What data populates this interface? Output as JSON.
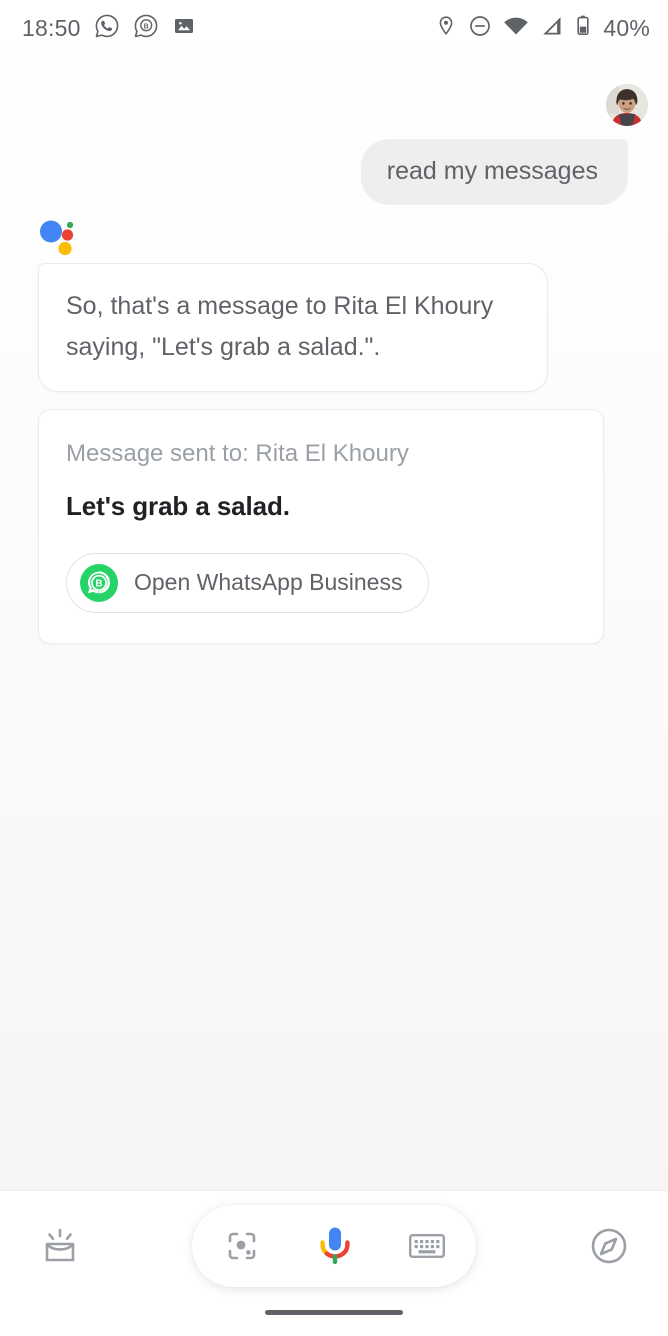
{
  "status_bar": {
    "time": "18:50",
    "battery_percent": "40%",
    "left_icons": [
      "whatsapp-icon",
      "whatsapp-business-icon",
      "photo-icon"
    ],
    "right_icons": [
      "location-icon",
      "do-not-disturb-icon",
      "wifi-icon",
      "cellular-signal-icon",
      "battery-icon"
    ],
    "text_color": "#5f6368"
  },
  "conversation": {
    "user_turn": {
      "avatar_name": "user-avatar",
      "message": "read my messages",
      "bubble_color": "#eeeeee",
      "text_color": "#5f6368"
    },
    "assistant_turn": {
      "logo_name": "google-assistant-logo",
      "logo_colors": {
        "blue": "#4285f4",
        "red": "#ea4335",
        "yellow": "#fbbc05",
        "green": "#34a853"
      },
      "message": "So, that's a message to Rita El Khoury saying, \"Let's grab a salad.\"."
    },
    "message_card": {
      "sent_to_label": "Message sent to: Rita El Khoury",
      "message_body": "Let's grab a salad.",
      "action_chip": {
        "label": "Open WhatsApp Business",
        "icon": "whatsapp-business-icon",
        "icon_color": "#25d366"
      }
    }
  },
  "bottom_bar": {
    "snapshot_icon": "snapshot-inbox-icon",
    "explore_icon": "explore-compass-icon",
    "pill": {
      "lens_icon": "google-lens-icon",
      "mic_icon": "google-microphone-icon",
      "keyboard_icon": "keyboard-icon"
    },
    "home_indicator": "home-indicator"
  }
}
